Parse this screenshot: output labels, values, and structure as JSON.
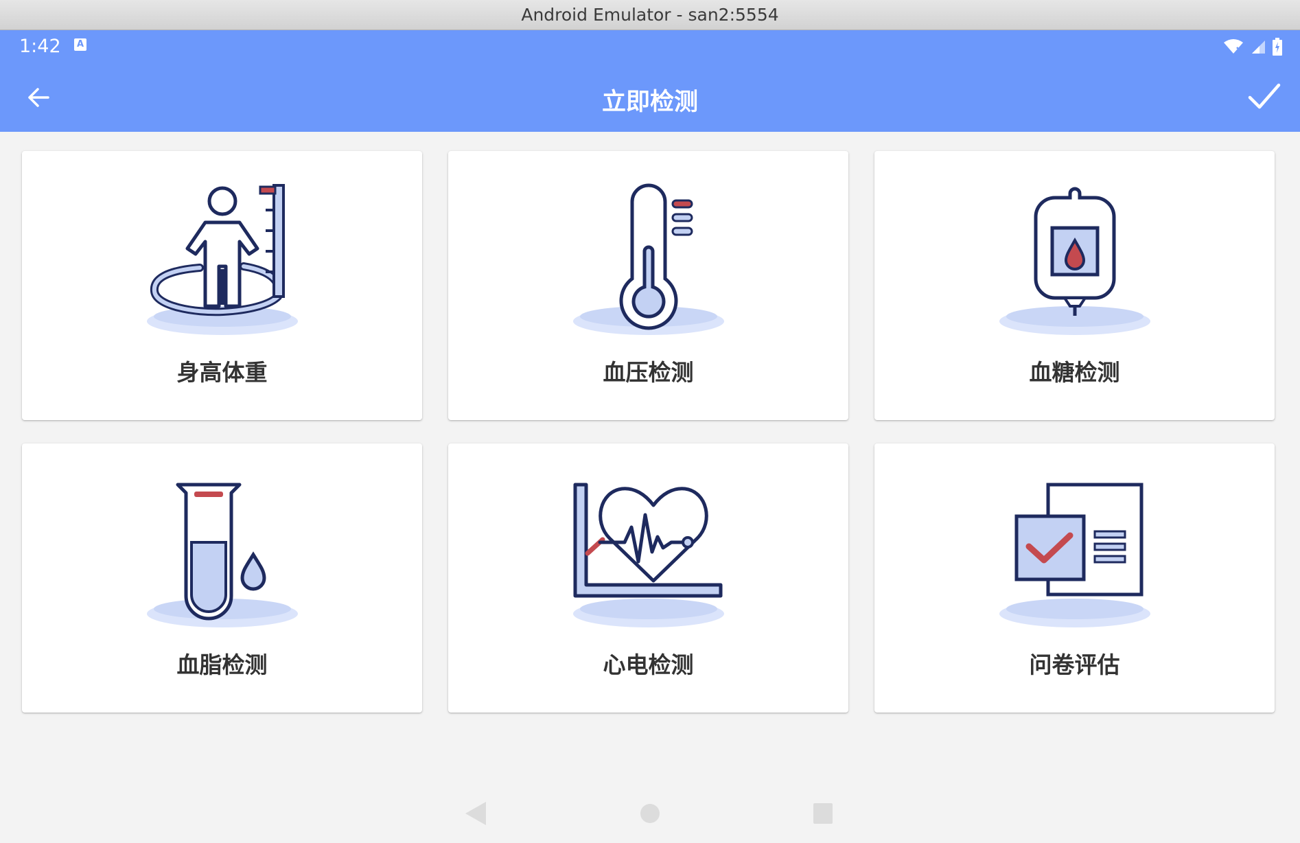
{
  "window": {
    "title": "Android Emulator - san2:5554"
  },
  "statusbar": {
    "time": "1:42",
    "keyboard_badge": "A"
  },
  "appbar": {
    "title": "立即检测"
  },
  "tiles": [
    {
      "label": "身高体重",
      "icon": "height-weight-icon"
    },
    {
      "label": "血压检测",
      "icon": "thermometer-icon"
    },
    {
      "label": "血糖检测",
      "icon": "blood-bag-icon"
    },
    {
      "label": "血脂检测",
      "icon": "test-tube-icon"
    },
    {
      "label": "心电检测",
      "icon": "heart-ecg-icon"
    },
    {
      "label": "问卷评估",
      "icon": "questionnaire-icon"
    }
  ],
  "colors": {
    "primary": "#6c98fb",
    "icon_outline": "#1e2a5e",
    "icon_fill": "#c3d1f3",
    "icon_accent": "#c44a4f"
  }
}
